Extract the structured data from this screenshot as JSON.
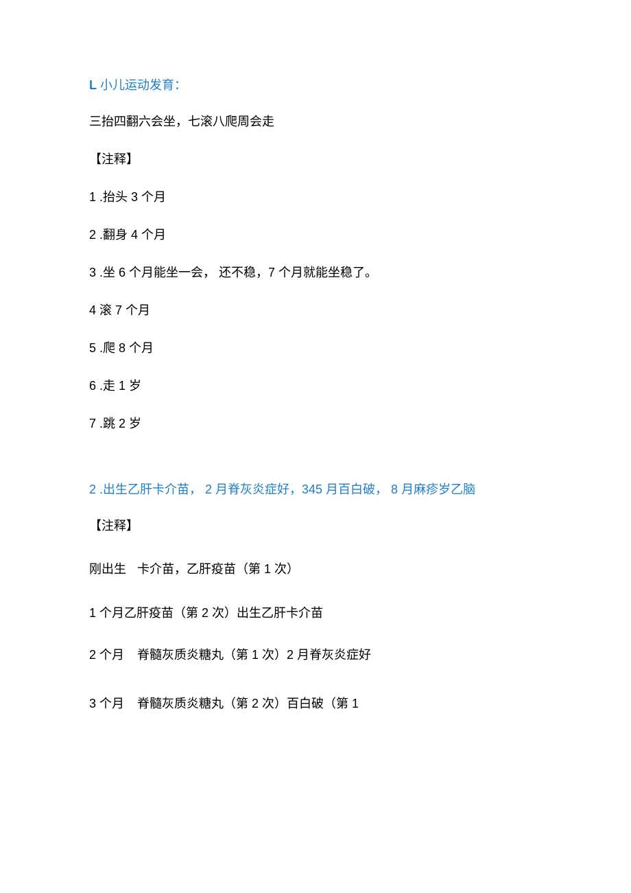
{
  "section1": {
    "heading_lead": "L",
    "heading_rest": " 小儿运动发育：",
    "mnemonic": "三抬四翻六会坐，七滚八爬周会走",
    "note_label": "【注释】",
    "items": [
      "1   .抬头 3 个月",
      "2   .翻身 4 个月",
      "3   .坐 6 个月能坐一会， 还不稳，7 个月就能坐稳了。",
      "4 滚 7 个月",
      "5   .爬 8 个月",
      "6   .走 1 岁",
      "7   .跳 2 岁"
    ]
  },
  "section2": {
    "heading": "2   .出生乙肝卡介苗， 2 月脊灰炎症好，345 月百白破， 8 月麻疹岁乙脑",
    "note_label": "【注释】",
    "rows": [
      {
        "left": "刚出生",
        "right": "卡介苗，乙肝疫苗（第 1 次）"
      },
      {
        "left": "1 个月乙肝疫苗（第 2 次）出生乙肝卡介苗",
        "right": ""
      },
      {
        "left": "2 个月",
        "right": "脊髓灰质炎糖丸（第 1 次）2 月脊灰炎症好"
      },
      {
        "left": "3 个月",
        "right": "脊髓灰质炎糖丸（第 2 次）百白破（第 1"
      }
    ]
  }
}
